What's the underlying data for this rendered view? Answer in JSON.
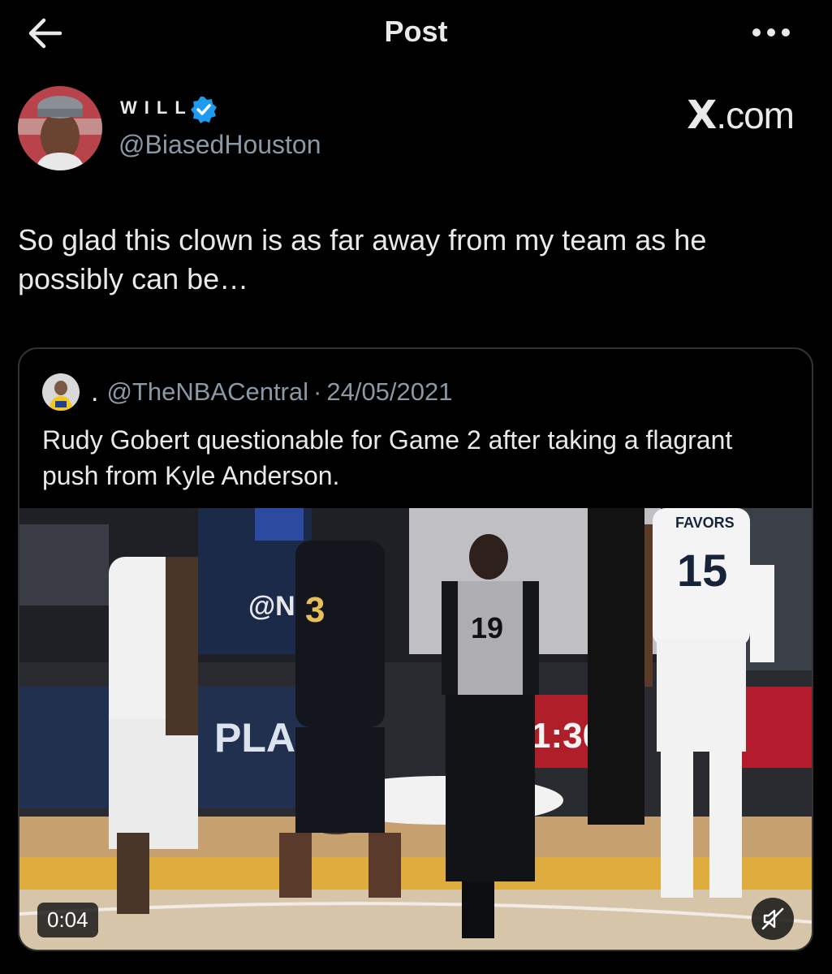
{
  "header": {
    "title": "Post",
    "back_icon": "arrow-left-icon",
    "more_icon": "more-horizontal-icon"
  },
  "author": {
    "display_name": "WILL",
    "handle": "@BiasedHouston",
    "verified_color": "#1d9bf0",
    "watermark_x": "X",
    "watermark_suffix": ".com"
  },
  "post": {
    "text": "So glad this clown is as far away from my team as he possibly can be…"
  },
  "quote": {
    "name": ".",
    "handle": "@TheNBACentral",
    "separator": "·",
    "date": "24/05/2021",
    "text": "Rudy Gobert questionable for Game 2 after taking a flagrant push from Kyle Anderson."
  },
  "video": {
    "duration": "0:04",
    "mute_icon": "volume-muted-icon",
    "jersey_19": "19",
    "jersey_15": "15",
    "jersey_3": "3",
    "name_favors": "FAVORS",
    "board_text": "1:30",
    "banner_text": "@NB",
    "play_text": "PLA"
  },
  "colors": {
    "background": "#000000",
    "text": "#e7e9ea",
    "secondary_text": "#8b98a5",
    "border": "#2f3336"
  }
}
